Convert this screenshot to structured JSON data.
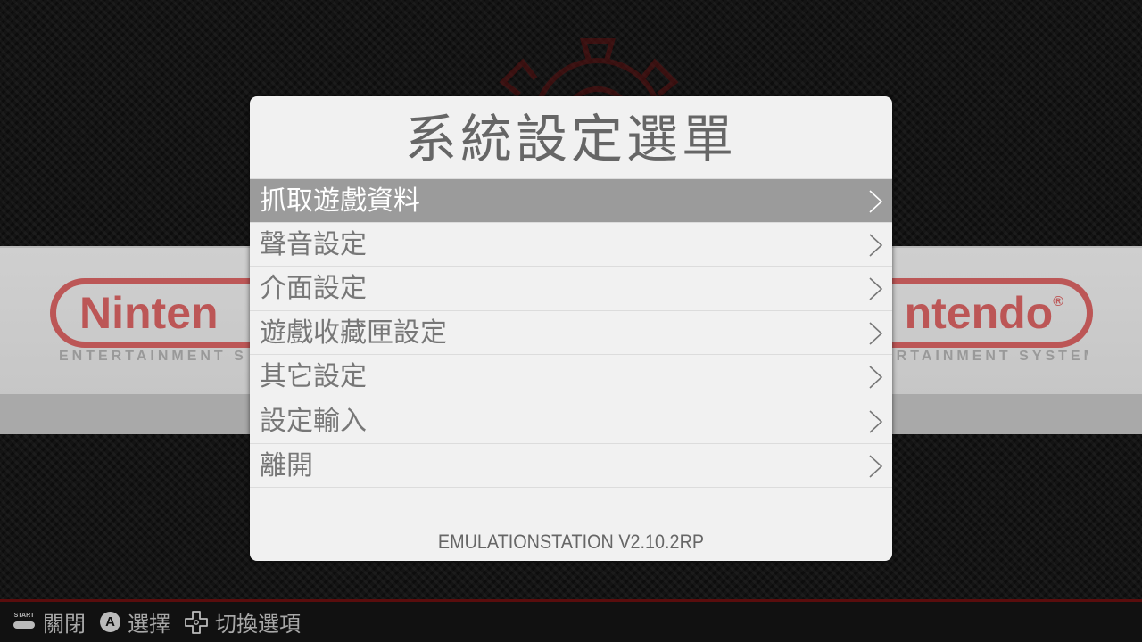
{
  "background": {
    "logo_left_text": "Ninten",
    "logo_right_text": "ntendo",
    "logo_mark": "®",
    "subline_left": "ENTERTAINMENT S",
    "subline_right": "ERTAINMENT SYSTEM",
    "gear_icon": "gear-icon"
  },
  "menu": {
    "title": "系統設定選單",
    "items": [
      {
        "label": "抓取遊戲資料",
        "selected": true
      },
      {
        "label": "聲音設定",
        "selected": false
      },
      {
        "label": "介面設定",
        "selected": false
      },
      {
        "label": "遊戲收藏匣設定",
        "selected": false
      },
      {
        "label": "其它設定",
        "selected": false
      },
      {
        "label": "設定輸入",
        "selected": false
      },
      {
        "label": "離開",
        "selected": false
      }
    ],
    "chevron_icon": "chevron-right-icon",
    "version": "EMULATIONSTATION V2.10.2RP"
  },
  "help": {
    "start_text": "START",
    "start_label": "關閉",
    "a_text": "A",
    "a_label": "選擇",
    "dpad_label": "切換選項"
  },
  "colors": {
    "panel": "#f1f1f1",
    "selected_row": "#9b9b9b",
    "text": "#777777",
    "accent_red": "#b93a3a"
  }
}
